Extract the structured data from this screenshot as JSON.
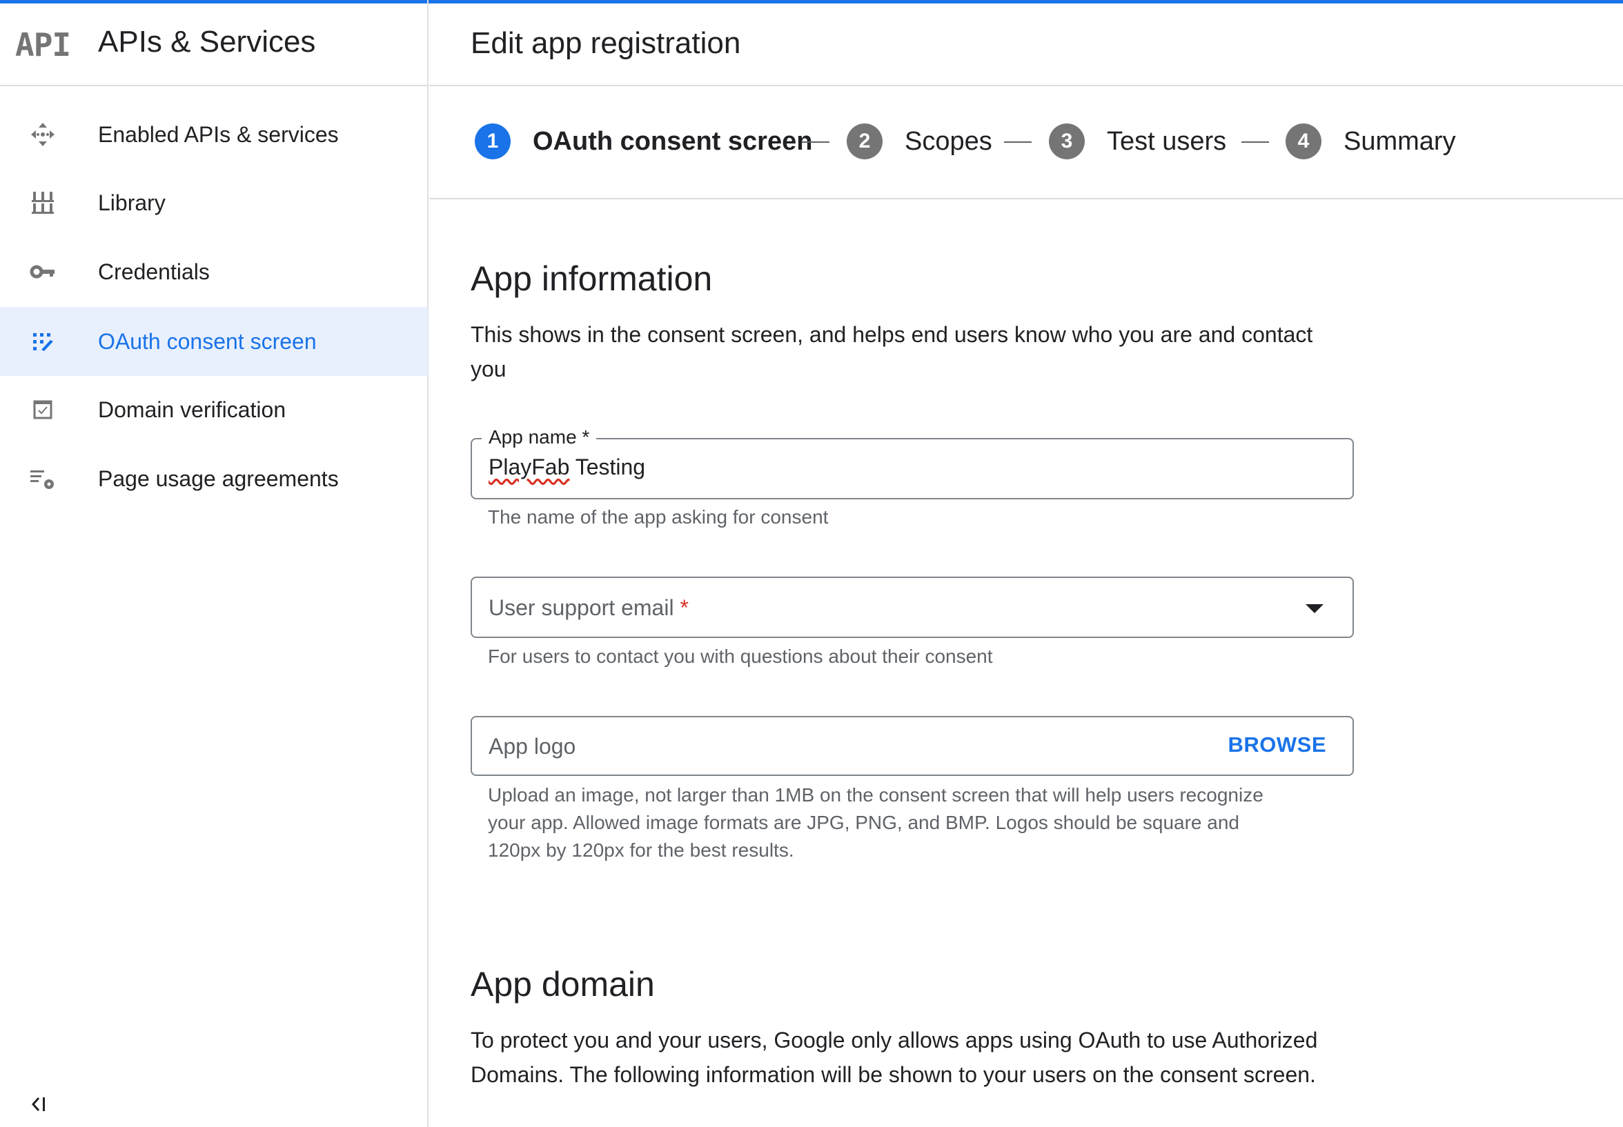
{
  "sidebar": {
    "logo_text": "API",
    "title": "APIs & Services",
    "items": [
      {
        "label": "Enabled APIs & services",
        "icon": "enabled-apis-icon",
        "active": false
      },
      {
        "label": "Library",
        "icon": "library-icon",
        "active": false
      },
      {
        "label": "Credentials",
        "icon": "key-icon",
        "active": false
      },
      {
        "label": "OAuth consent screen",
        "icon": "oauth-consent-icon",
        "active": true
      },
      {
        "label": "Domain verification",
        "icon": "checkbox-icon",
        "active": false
      },
      {
        "label": "Page usage agreements",
        "icon": "settings-list-icon",
        "active": false
      }
    ],
    "collapse_icon": "collapse-sidebar-icon"
  },
  "header": {
    "title": "Edit app registration"
  },
  "stepper": {
    "steps": [
      {
        "number": "1",
        "label": "OAuth consent screen",
        "active": true
      },
      {
        "number": "2",
        "label": "Scopes",
        "active": false
      },
      {
        "number": "3",
        "label": "Test users",
        "active": false
      },
      {
        "number": "4",
        "label": "Summary",
        "active": false
      }
    ]
  },
  "app_information": {
    "heading": "App information",
    "description_line1": "This shows in the consent screen, and helps end users know who you are and contact",
    "description_line2": "you",
    "app_name": {
      "label": "App name *",
      "value_misspelled": "PlayFab",
      "value_rest": " Testing",
      "hint": "The name of the app asking for consent"
    },
    "support_email": {
      "placeholder": "User support email",
      "required_mark": "*",
      "hint": "For users to contact you with questions about their consent"
    },
    "app_logo": {
      "placeholder": "App logo",
      "browse_label": "BROWSE",
      "hint_line1": "Upload an image, not larger than 1MB on the consent screen that will help users recognize",
      "hint_line2": "your app. Allowed image formats are JPG, PNG, and BMP. Logos should be square and",
      "hint_line3": "120px by 120px for the best results."
    }
  },
  "app_domain": {
    "heading": "App domain",
    "description_line1": "To protect you and your users, Google only allows apps using OAuth to use Authorized",
    "description_line2": "Domains. The following information will be shown to your users on the consent screen."
  },
  "colors": {
    "accent": "#1a73e8",
    "active_bg": "#e8f0fe",
    "required": "#d93025",
    "step_inactive": "#757575"
  }
}
